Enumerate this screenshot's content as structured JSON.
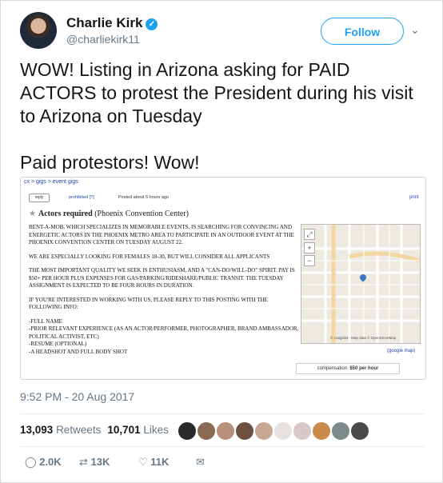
{
  "tweet": {
    "author_name": "Charlie Kirk",
    "handle": "@charliekirk11",
    "follow_label": "Follow",
    "caret": "⌄",
    "text_lines": [
      "WOW! Listing in Arizona asking for PAID ACTORS to protest the President during his visit to Arizona on Tuesday",
      "Paid protestors! Wow!"
    ],
    "timestamp": "9:52 PM - 20 Aug 2017",
    "retweets_count": "13,093",
    "retweets_label": "Retweets",
    "likes_count": "10,701",
    "likes_label": "Likes",
    "actions": {
      "reply_count": "2.0K",
      "retweet_count": "13K",
      "like_count": "11K"
    }
  },
  "craigslist": {
    "breadcrumb": "cx > gigs > event gigs",
    "reply_label": "reply",
    "prohibited_label": "prohibited [?]",
    "posted_label": "Posted about 5 hours ago",
    "print_label": "print",
    "title": "Actors required",
    "location": "(Phoenix Convention Center)",
    "paragraphs": [
      "RENT-A-MOB, WHICH SPECIALIZES IN MEMORABLE EVENTS, IS SEARCHING FOR CONVINCING AND ENERGETIC ACTORS IN THE PHOENIX METRO AREA TO PARTICIPATE IN AN OUTDOOR EVENT AT THE PHOENIX CONVENTION CENTER ON TUESDAY AUGUST 22.",
      "WE ARE ESPECIALLY LOOKING FOR FEMALES 18-30, BUT WILL CONSIDER ALL APPLICANTS",
      "THE MOST IMPORTANT QUALITY WE SEEK IS ENTHUSIASM, AND A \"CAN-DO/WILL-DO\" SPIRIT. PAY IS $50+ PER HOUR PLUS EXPENSES FOR GAS/PARKING/RIDESHARE/PUBLIC TRANSIT. THE TUESDAY ASSIGNMENT IS EXPECTED TO BE FOUR HOURS IN DURATION.",
      "IF YOU'RE INTERESTED IN WORKING WITH US, PLEASE REPLY TO THIS POSTING WITH THE FOLLOWING INFO:",
      "-FULL NAME\n-PRIOR RELEVANT EXPERIENCE (AS AN ACTOR/PERFORMER, PHOTOGRAPHER, BRAND AMBASSADOR, POLITICAL ACTIVIST, ETC)\n-RESUME (OPTIONAL)\n-A HEADSHOT AND FULL BODY SHOT"
    ],
    "map_attribution": "© craigslist - Map data © OpenStreetMap",
    "google_map_label": "(google map)",
    "compensation_label": "compensation:",
    "compensation_value": "$50 per hour"
  },
  "colors": {
    "accent": "#1da1f2",
    "text": "#14171a",
    "muted": "#657786",
    "link": "#2244aa"
  }
}
